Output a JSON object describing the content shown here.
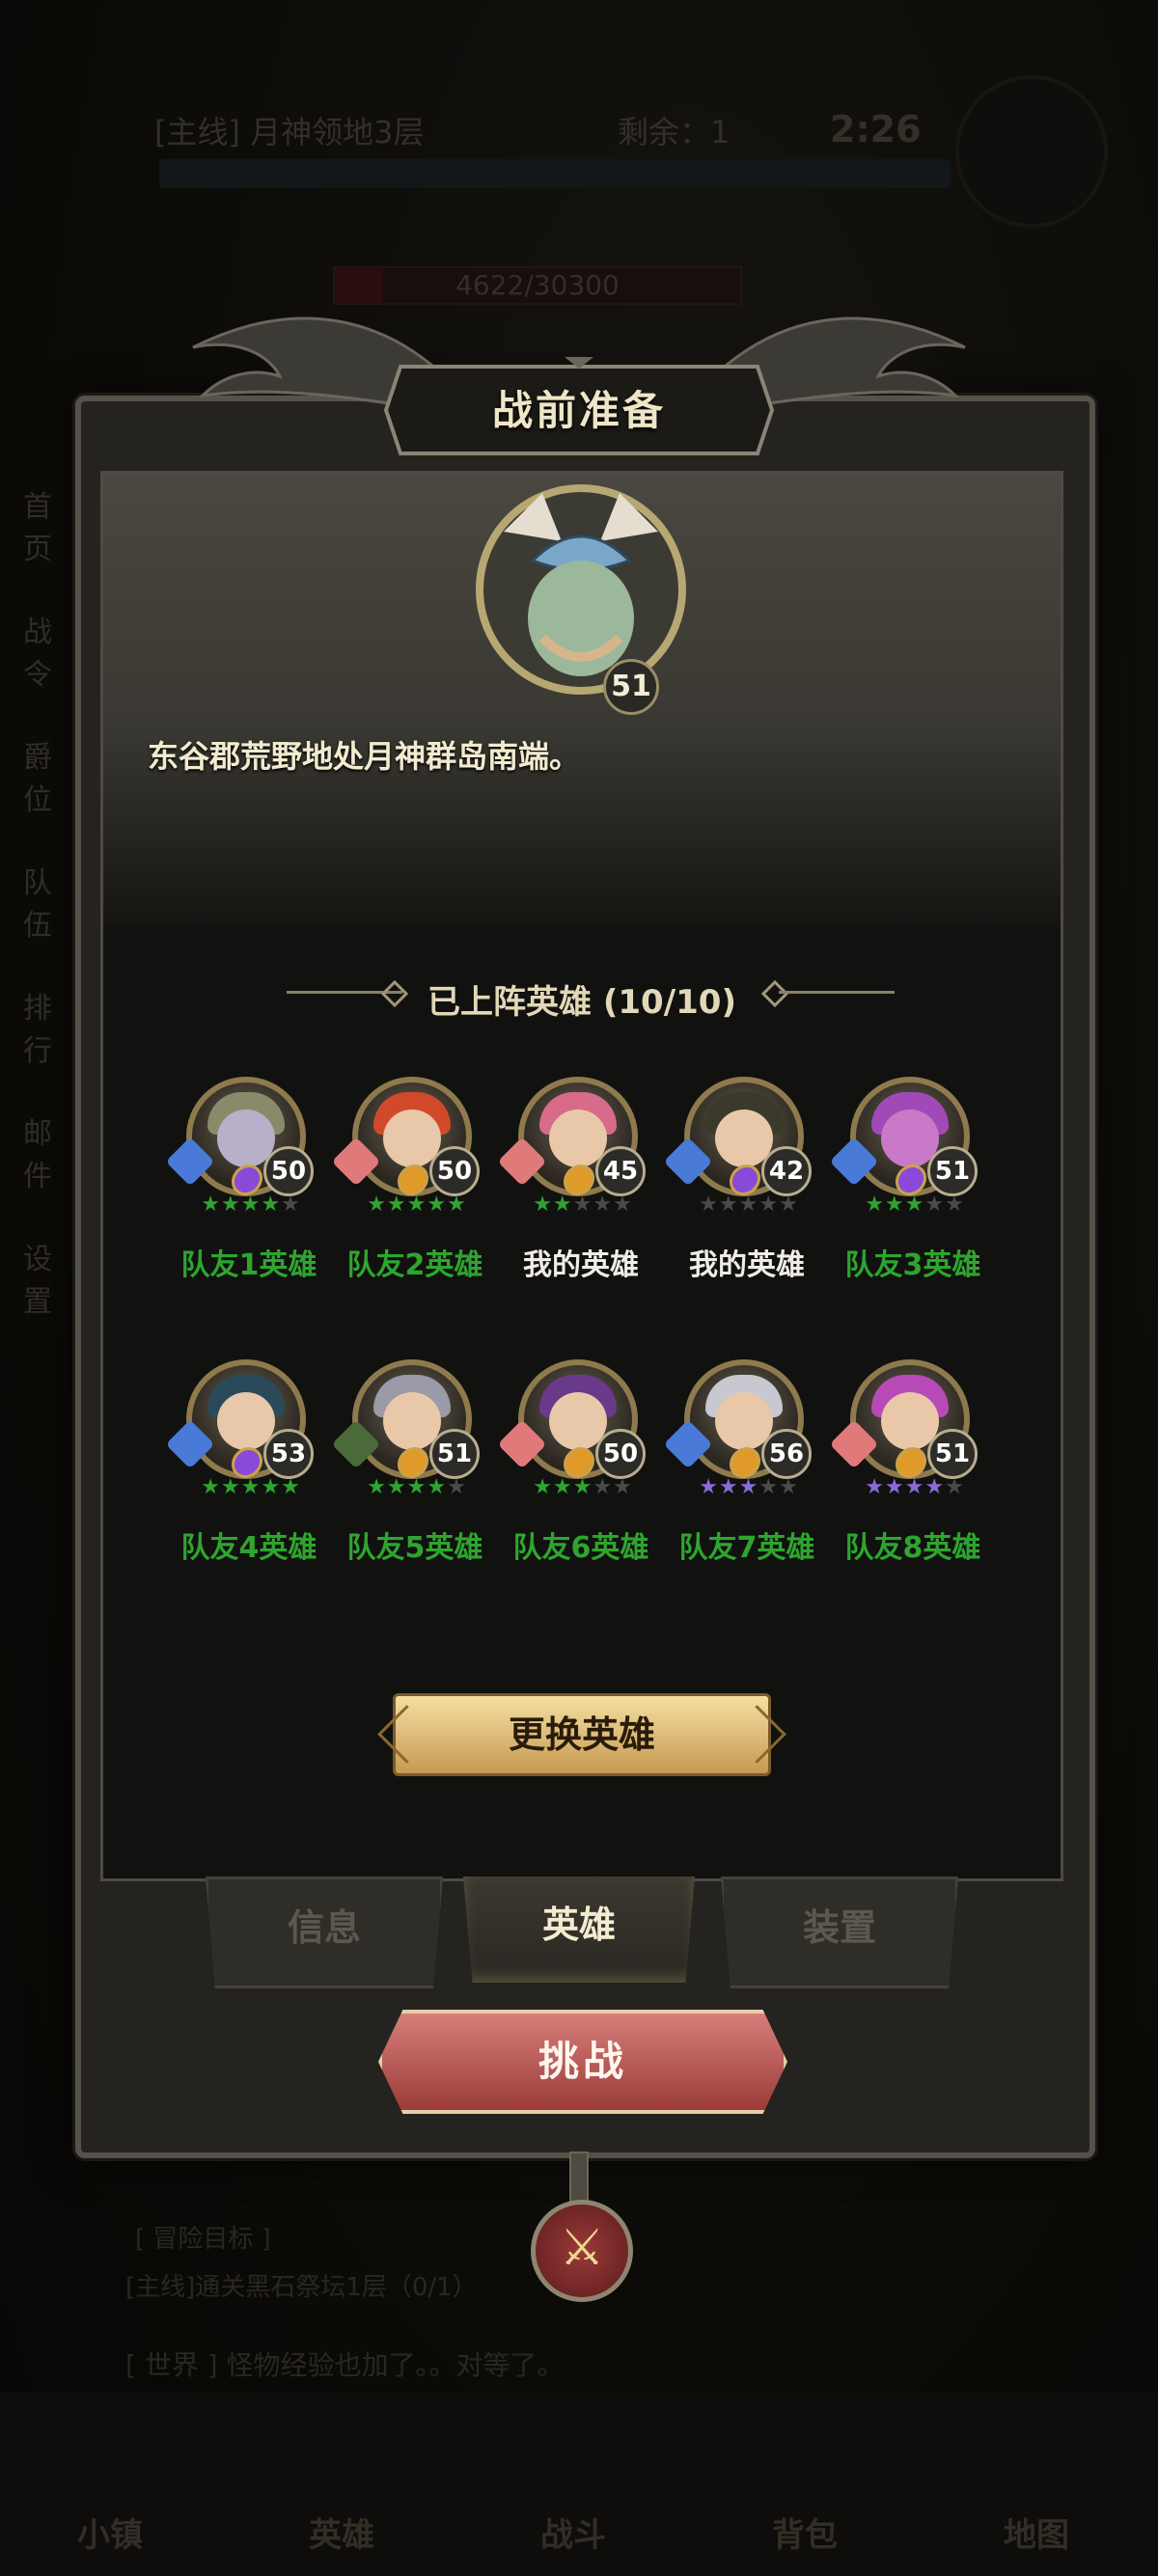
{
  "background": {
    "quest_label": "[主线] 月神领地3层",
    "remaining": "剩余：1",
    "timer": "2:26",
    "boss_hp": "4622/30300",
    "boss_level": "51",
    "side_items": [
      "首页",
      "战令",
      "爵位",
      "队伍",
      "排行",
      "邮件",
      "设置"
    ],
    "adventure_title": "[ 冒险目标 ]",
    "adventure_goal": "[主线]通关黑石祭坛1层（0/1）",
    "chat_text": "[ 世界 ] 怪物经验也加了。。对等了。",
    "bottom_nav": [
      "小镇",
      "英雄",
      "战斗",
      "背包",
      "地图"
    ]
  },
  "dialog": {
    "title": "战前准备",
    "boss_level": "51",
    "description": "东谷郡荒野地处月神群岛南端。",
    "heroes_section_title": "已上阵英雄 (10/10)",
    "heroes": [
      {
        "name": "队友1英雄",
        "level": "50",
        "stars": "★★★★★",
        "name_color": "green"
      },
      {
        "name": "队友2英雄",
        "level": "50",
        "stars": "★★★★★",
        "name_color": "green"
      },
      {
        "name": "我的英雄",
        "level": "45",
        "stars": "★★★★★",
        "name_color": "white"
      },
      {
        "name": "我的英雄",
        "level": "42",
        "stars": "★★★★★",
        "name_color": "white"
      },
      {
        "name": "队友3英雄",
        "level": "51",
        "stars": "★★★★★",
        "name_color": "green"
      },
      {
        "name": "队友4英雄",
        "level": "53",
        "stars": "★★★★★",
        "name_color": "green"
      },
      {
        "name": "队友5英雄",
        "level": "51",
        "stars": "★★★★★",
        "name_color": "green"
      },
      {
        "name": "队友6英雄",
        "level": "50",
        "stars": "★★★★★",
        "name_color": "green"
      },
      {
        "name": "队友7英雄",
        "level": "56",
        "stars": "★★★★★",
        "name_color": "green"
      },
      {
        "name": "队友8英雄",
        "level": "51",
        "stars": "★★★★★",
        "name_color": "green"
      }
    ],
    "swap_button": "更换英雄",
    "tabs": [
      {
        "label": "信息",
        "active": false
      },
      {
        "label": "英雄",
        "active": true
      },
      {
        "label": "装置",
        "active": false
      }
    ],
    "challenge_button": "挑战",
    "close_icon": "crossed-swords-icon"
  },
  "colors": {
    "green_text": "#2ea52e",
    "white_text": "#f0ede4",
    "gold_button": "#d9b56e",
    "red_button": "#b4504c"
  }
}
